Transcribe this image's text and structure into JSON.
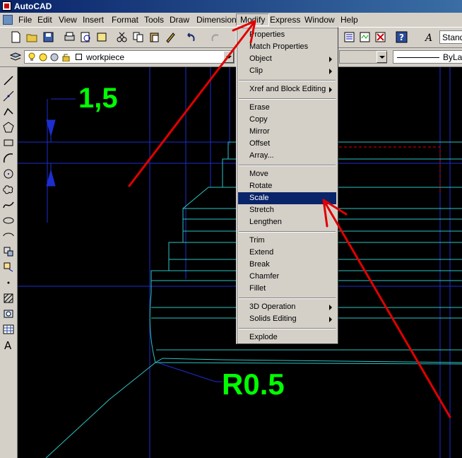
{
  "window": {
    "title": "AutoCAD"
  },
  "menubar": [
    "File",
    "Edit",
    "View",
    "Insert",
    "Format",
    "Tools",
    "Draw",
    "Dimension",
    "Modify",
    "Express",
    "Window",
    "Help"
  ],
  "toolbar": {
    "text_style": "Standard"
  },
  "layers": {
    "current_layer": "workpiece",
    "linetype": "ByLayer"
  },
  "drawing": {
    "dim_upper": "1,5",
    "dim_radius": "R0.5"
  },
  "modify_menu": {
    "groups": [
      [
        "Properties",
        "Match Properties",
        "Object",
        "Clip"
      ],
      [
        "Xref and Block Editing"
      ],
      [
        "Erase",
        "Copy",
        "Mirror",
        "Offset",
        "Array..."
      ],
      [
        "Move",
        "Rotate",
        "Scale",
        "Stretch",
        "Lengthen"
      ],
      [
        "Trim",
        "Extend",
        "Break",
        "Chamfer",
        "Fillet"
      ],
      [
        "3D Operation",
        "Solids Editing"
      ],
      [
        "Explode"
      ]
    ],
    "submenu_items": [
      "Object",
      "Clip",
      "Xref and Block Editing",
      "3D Operation",
      "Solids Editing"
    ],
    "highlighted": "Scale"
  },
  "colors": {
    "dimension_text": "#00ff00",
    "arrow": "#e00000",
    "outline": "#2ec4c4",
    "construction": "#1c2ecf",
    "highlight": "#0a246a"
  },
  "left_toolbar_icons": [
    "line-icon",
    "construction-line-icon",
    "polyline-icon",
    "polygon-icon",
    "rectangle-icon",
    "arc-icon",
    "circle-icon",
    "revision-cloud-icon",
    "spline-icon",
    "ellipse-icon",
    "ellipse-arc-icon",
    "insert-block-icon",
    "make-block-icon",
    "point-icon",
    "hatch-icon",
    "region-icon",
    "table-icon",
    "multiline-text-icon"
  ]
}
